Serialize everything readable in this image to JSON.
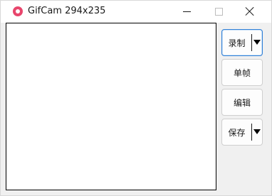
{
  "window": {
    "title": "GifCam 294x235",
    "app_icon": "gifcam-icon",
    "controls": {
      "minimize": "minimize-icon",
      "maximize": "maximize-icon",
      "close": "close-icon"
    }
  },
  "buttons": {
    "record": {
      "label": "录制",
      "has_dropdown": true
    },
    "frame": {
      "label": "单帧"
    },
    "edit": {
      "label": "编辑"
    },
    "save": {
      "label": "保存",
      "has_dropdown": true
    }
  },
  "colors": {
    "accent": "#2f7fd6",
    "app_icon": "#e8466c"
  }
}
